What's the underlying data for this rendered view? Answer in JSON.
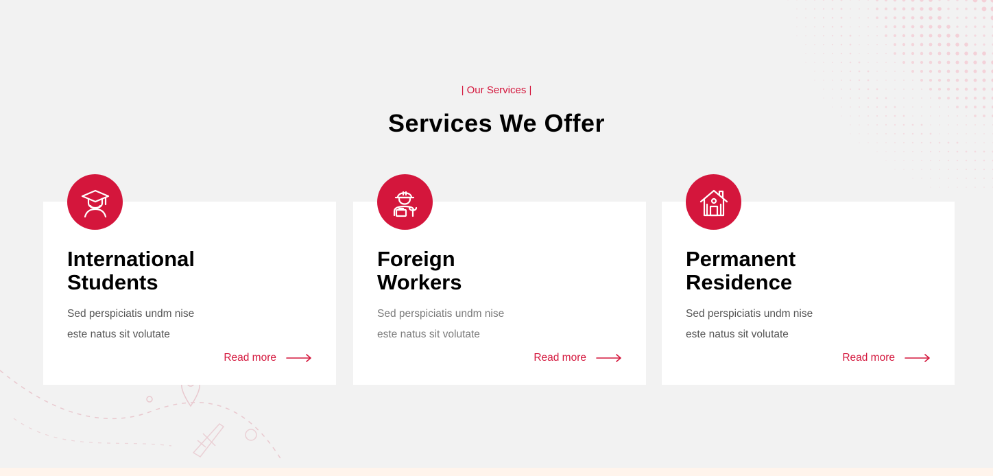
{
  "section": {
    "eyebrow": "| Our Services |",
    "title": "Services We Offer"
  },
  "cards": [
    {
      "icon": "graduate-icon",
      "title": "International\nStudents",
      "description": "Sed perspiciatis undm nise\neste natus sit volutate",
      "link_label": "Read more"
    },
    {
      "icon": "worker-icon",
      "title": "Foreign\nWorkers",
      "description": "Sed perspiciatis undm nise\neste natus sit volutate",
      "link_label": "Read more"
    },
    {
      "icon": "house-icon",
      "title": "Permanent\nResidence",
      "description": "Sed perspiciatis undm nise\neste natus sit volutate",
      "link_label": "Read more"
    }
  ],
  "colors": {
    "accent": "#d4163c",
    "background": "#f2f2f2",
    "card": "#ffffff",
    "heading": "#000000"
  }
}
